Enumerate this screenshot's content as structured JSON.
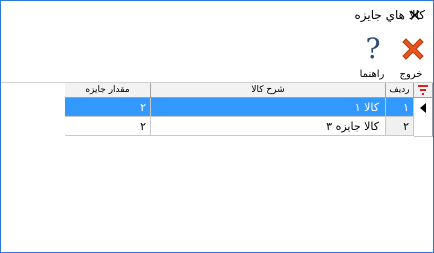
{
  "window": {
    "title": "كالا هاي جايزه",
    "close_glyph": "✕"
  },
  "toolbar": {
    "exit_label": "خروج",
    "help_label": "راهنما"
  },
  "grid": {
    "columns": {
      "row": "رديف",
      "description": "شرح كالا",
      "quantity": "مقدار جايزه"
    },
    "rows": [
      {
        "row": "١",
        "description": "كالا ١",
        "quantity": "٢"
      },
      {
        "row": "٢",
        "description": "كالا جايزه ٣",
        "quantity": "٢"
      }
    ]
  },
  "colors": {
    "selection": "#3399ff",
    "exit_icon": "#e8541e",
    "help_icon": "#2f4a78",
    "filter_icon": "#e02020"
  },
  "icons": {
    "exit": "close-x-icon",
    "help": "question-mark-icon",
    "filter": "filter-icon",
    "current_row": "row-pointer-icon"
  }
}
